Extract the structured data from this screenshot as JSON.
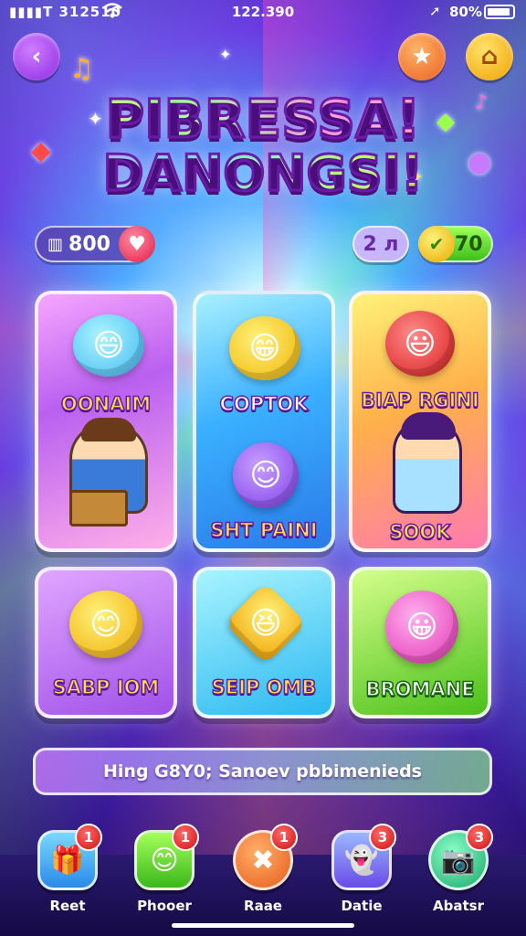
{
  "status_bar": {
    "signal": "▮▮▮▮T 312510",
    "wifi_icon": "wifi-icon",
    "time": "122.390",
    "location_icon": "location-arrow-icon",
    "battery": "80%"
  },
  "header": {
    "back_icon": "back-arrow-icon",
    "star_icon": "star-icon",
    "home_icon": "home-icon"
  },
  "title": {
    "line1": "PIBRESSA!",
    "line2": "DANONGSI!"
  },
  "stats": {
    "score": "800",
    "level": "2 л",
    "coins": "70"
  },
  "cards": [
    {
      "label": "OONAIM",
      "char": "😄"
    },
    {
      "label": "COPTOK",
      "char": "😁"
    },
    {
      "label": "BIAP RGINI",
      "char": "😃"
    },
    {
      "label": "SABP IOM",
      "char": "😊"
    },
    {
      "label": "SEIP OMB",
      "char": "😆"
    },
    {
      "label": "BROMANE",
      "char": "😀"
    }
  ],
  "card_sub": {
    "c2_bottom": "SHT PAINI",
    "c3_bottom": "SOOK"
  },
  "hint": "Hing G8Y0; Sanoev pbbimenieds",
  "nav": [
    {
      "label": "Reet",
      "badge": "1",
      "icon": "gift-box-icon"
    },
    {
      "label": "Phooer",
      "badge": "1",
      "icon": "smiley-icon"
    },
    {
      "label": "Raae",
      "badge": "1",
      "icon": "close-icon"
    },
    {
      "label": "Datie",
      "badge": "3",
      "icon": "ghost-icon"
    },
    {
      "label": "Abatsr",
      "badge": "3",
      "icon": "camera-icon"
    }
  ],
  "colors": {
    "accent_purple": "#8a2be2",
    "badge_red": "#d01010",
    "coin_green": "#3fc01a"
  }
}
